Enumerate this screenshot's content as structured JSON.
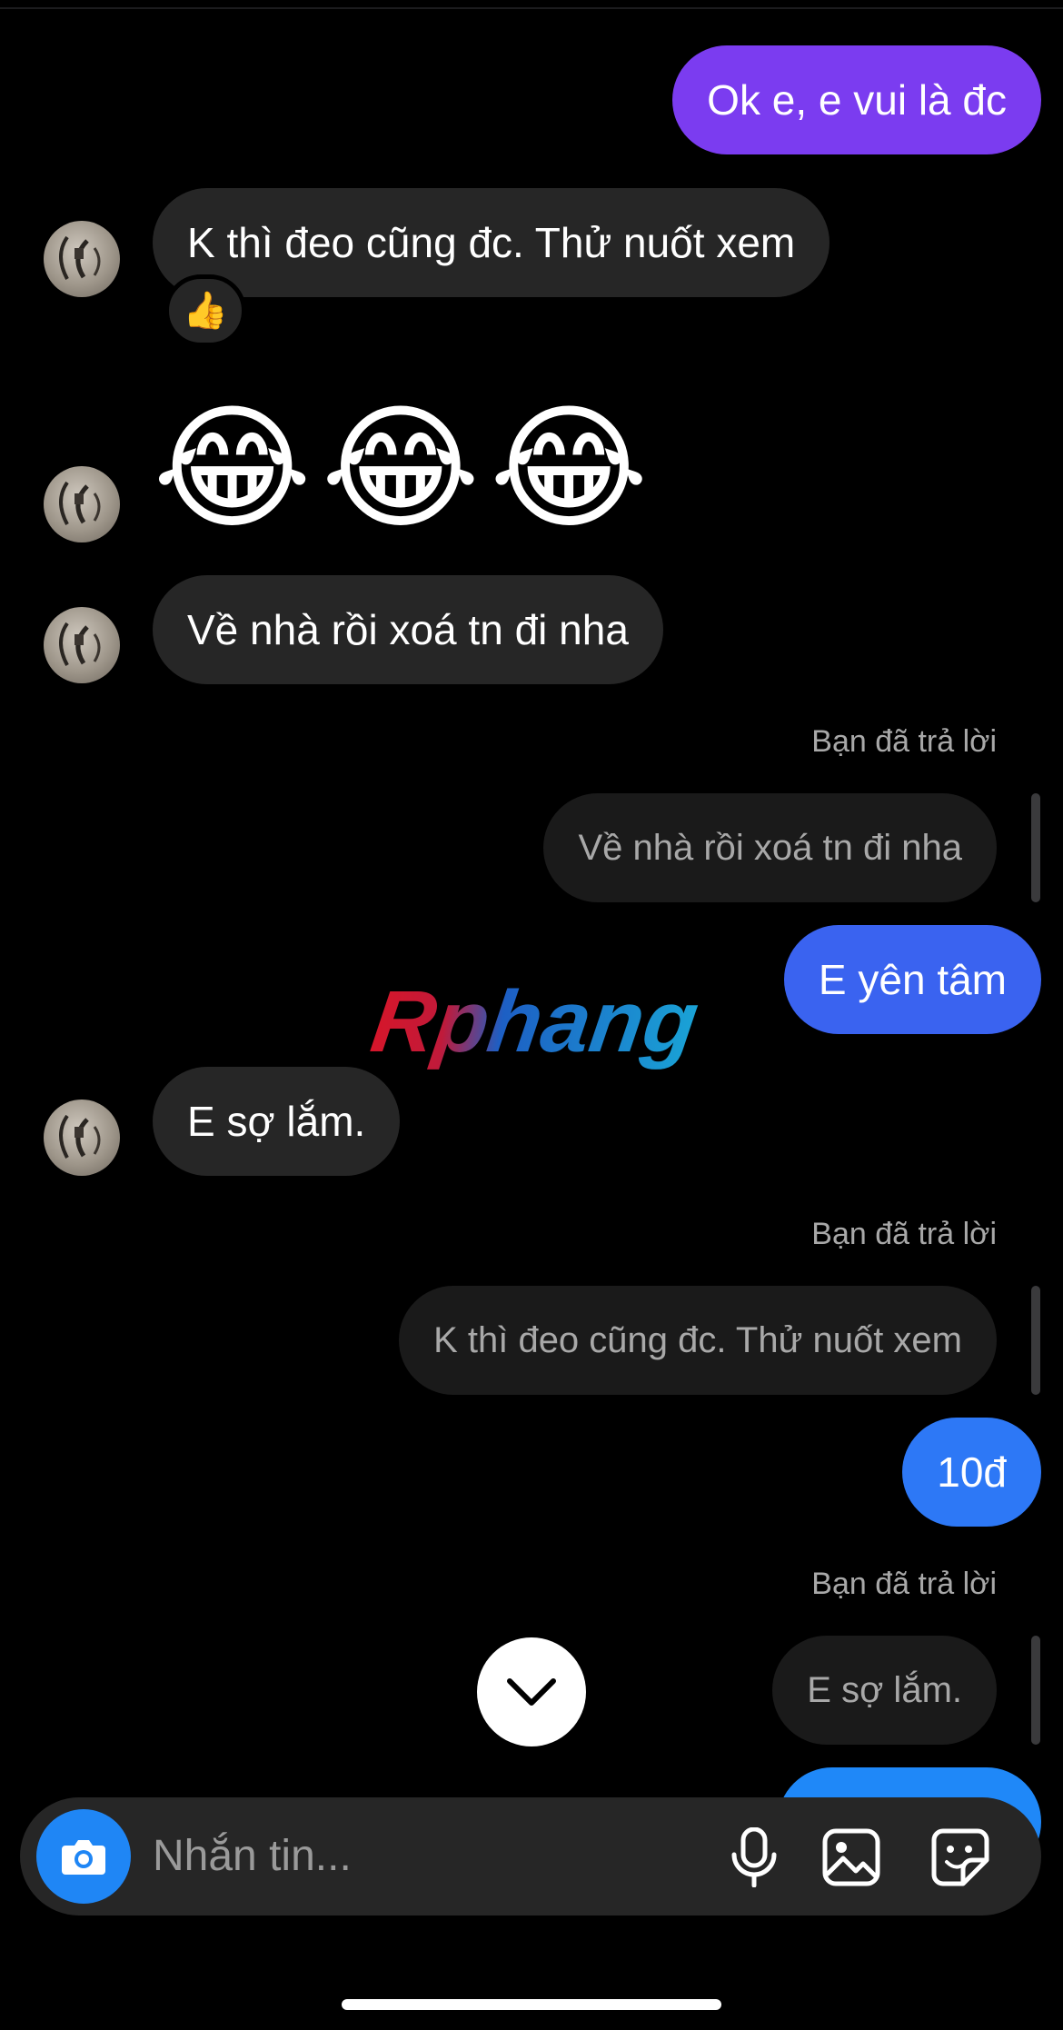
{
  "conversation": {
    "messages": [
      {
        "id": "m1",
        "sender": "me",
        "text": "Ok e, e vui là đc"
      },
      {
        "id": "m2",
        "sender": "them",
        "text": "K thì đeo cũng đc. Thử nuốt xem",
        "reaction": "👍"
      },
      {
        "id": "m3",
        "sender": "them",
        "text": "😂😂😂"
      },
      {
        "id": "m4",
        "sender": "them",
        "text": "Về nhà rồi xoá tn đi nha"
      },
      {
        "id": "m5",
        "sender": "me",
        "reply_label": "Bạn đã trả lời",
        "quoted": "Về nhà rồi xoá tn đi nha",
        "text": "E yên tâm"
      },
      {
        "id": "m6",
        "sender": "them",
        "text": "E sợ lắm."
      },
      {
        "id": "m7",
        "sender": "me",
        "reply_label": "Bạn đã trả lời",
        "quoted": "K thì đeo cũng đc. Thử nuốt xem",
        "text": "10đ"
      },
      {
        "id": "m8",
        "sender": "me",
        "reply_label": "Bạn đã trả lời",
        "quoted": "E sợ lắm.",
        "text": ""
      }
    ]
  },
  "watermark": {
    "text": "Rphang"
  },
  "composer": {
    "placeholder": "Nhắn tin...",
    "icons": [
      "camera-icon",
      "microphone-icon",
      "gallery-icon",
      "sticker-icon"
    ]
  },
  "icons": {
    "scroll_down": "chevron-down-icon"
  },
  "colors": {
    "background": "#000000",
    "received_bubble": "#262626",
    "sent_gradient_top": "#7b3cf0",
    "sent_gradient_bottom": "#1f88f8",
    "accent": "#1f86f5"
  }
}
